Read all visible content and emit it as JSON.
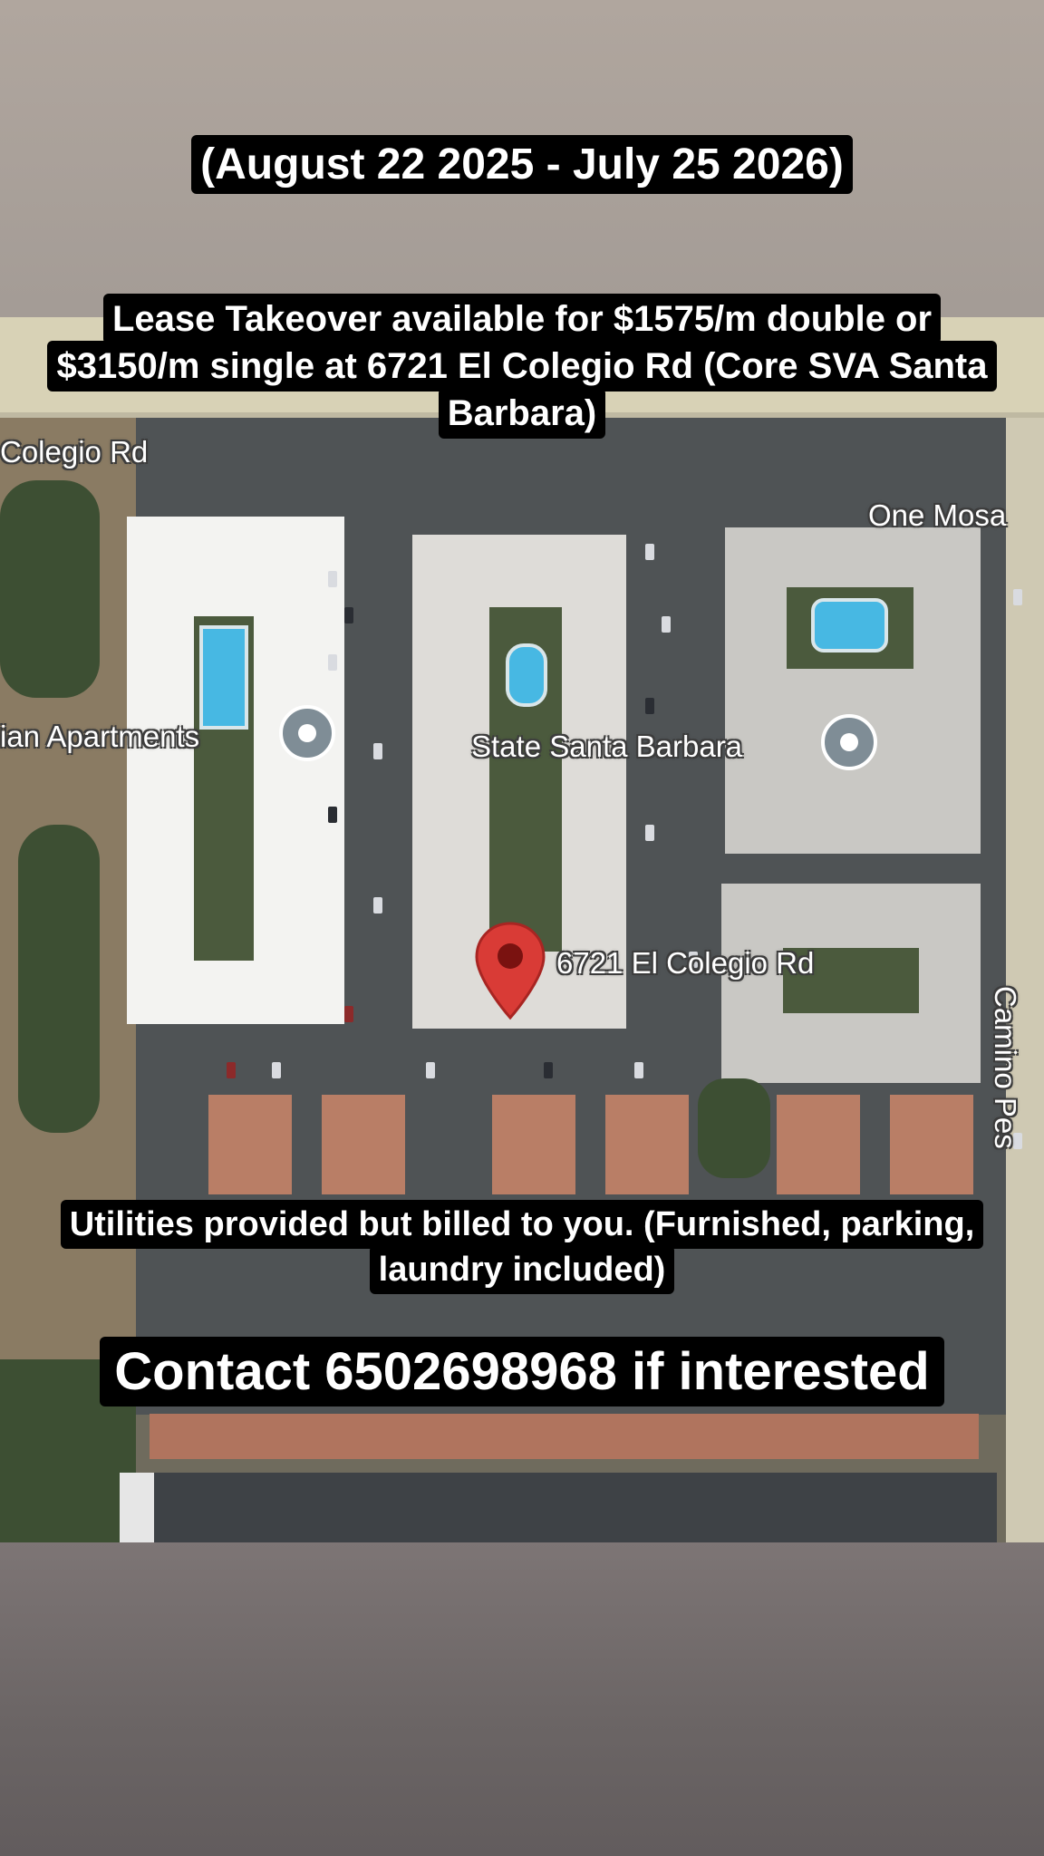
{
  "overlay": {
    "dates": "(August 22 2025 - July 25 2026)",
    "lease": "Lease Takeover available for $1575/m double or $3150/m single at 6721 El Colegio Rd (Core SVA Santa Barbara)",
    "utilities": "Utilities provided but billed to you. (Furnished, parking, laundry included)",
    "contact": "Contact 6502698968 if interested"
  },
  "map": {
    "road_label": "Colegio Rd",
    "road_label_right": "One Mosa",
    "poi_left": "ian Apartments",
    "poi_center": "State Santa Barbara",
    "pin_label": "6721 El Colegio Rd",
    "side_road_label": "Camino Pes",
    "pin_color": "#d93b36",
    "poi_color": "#7f8d96"
  }
}
